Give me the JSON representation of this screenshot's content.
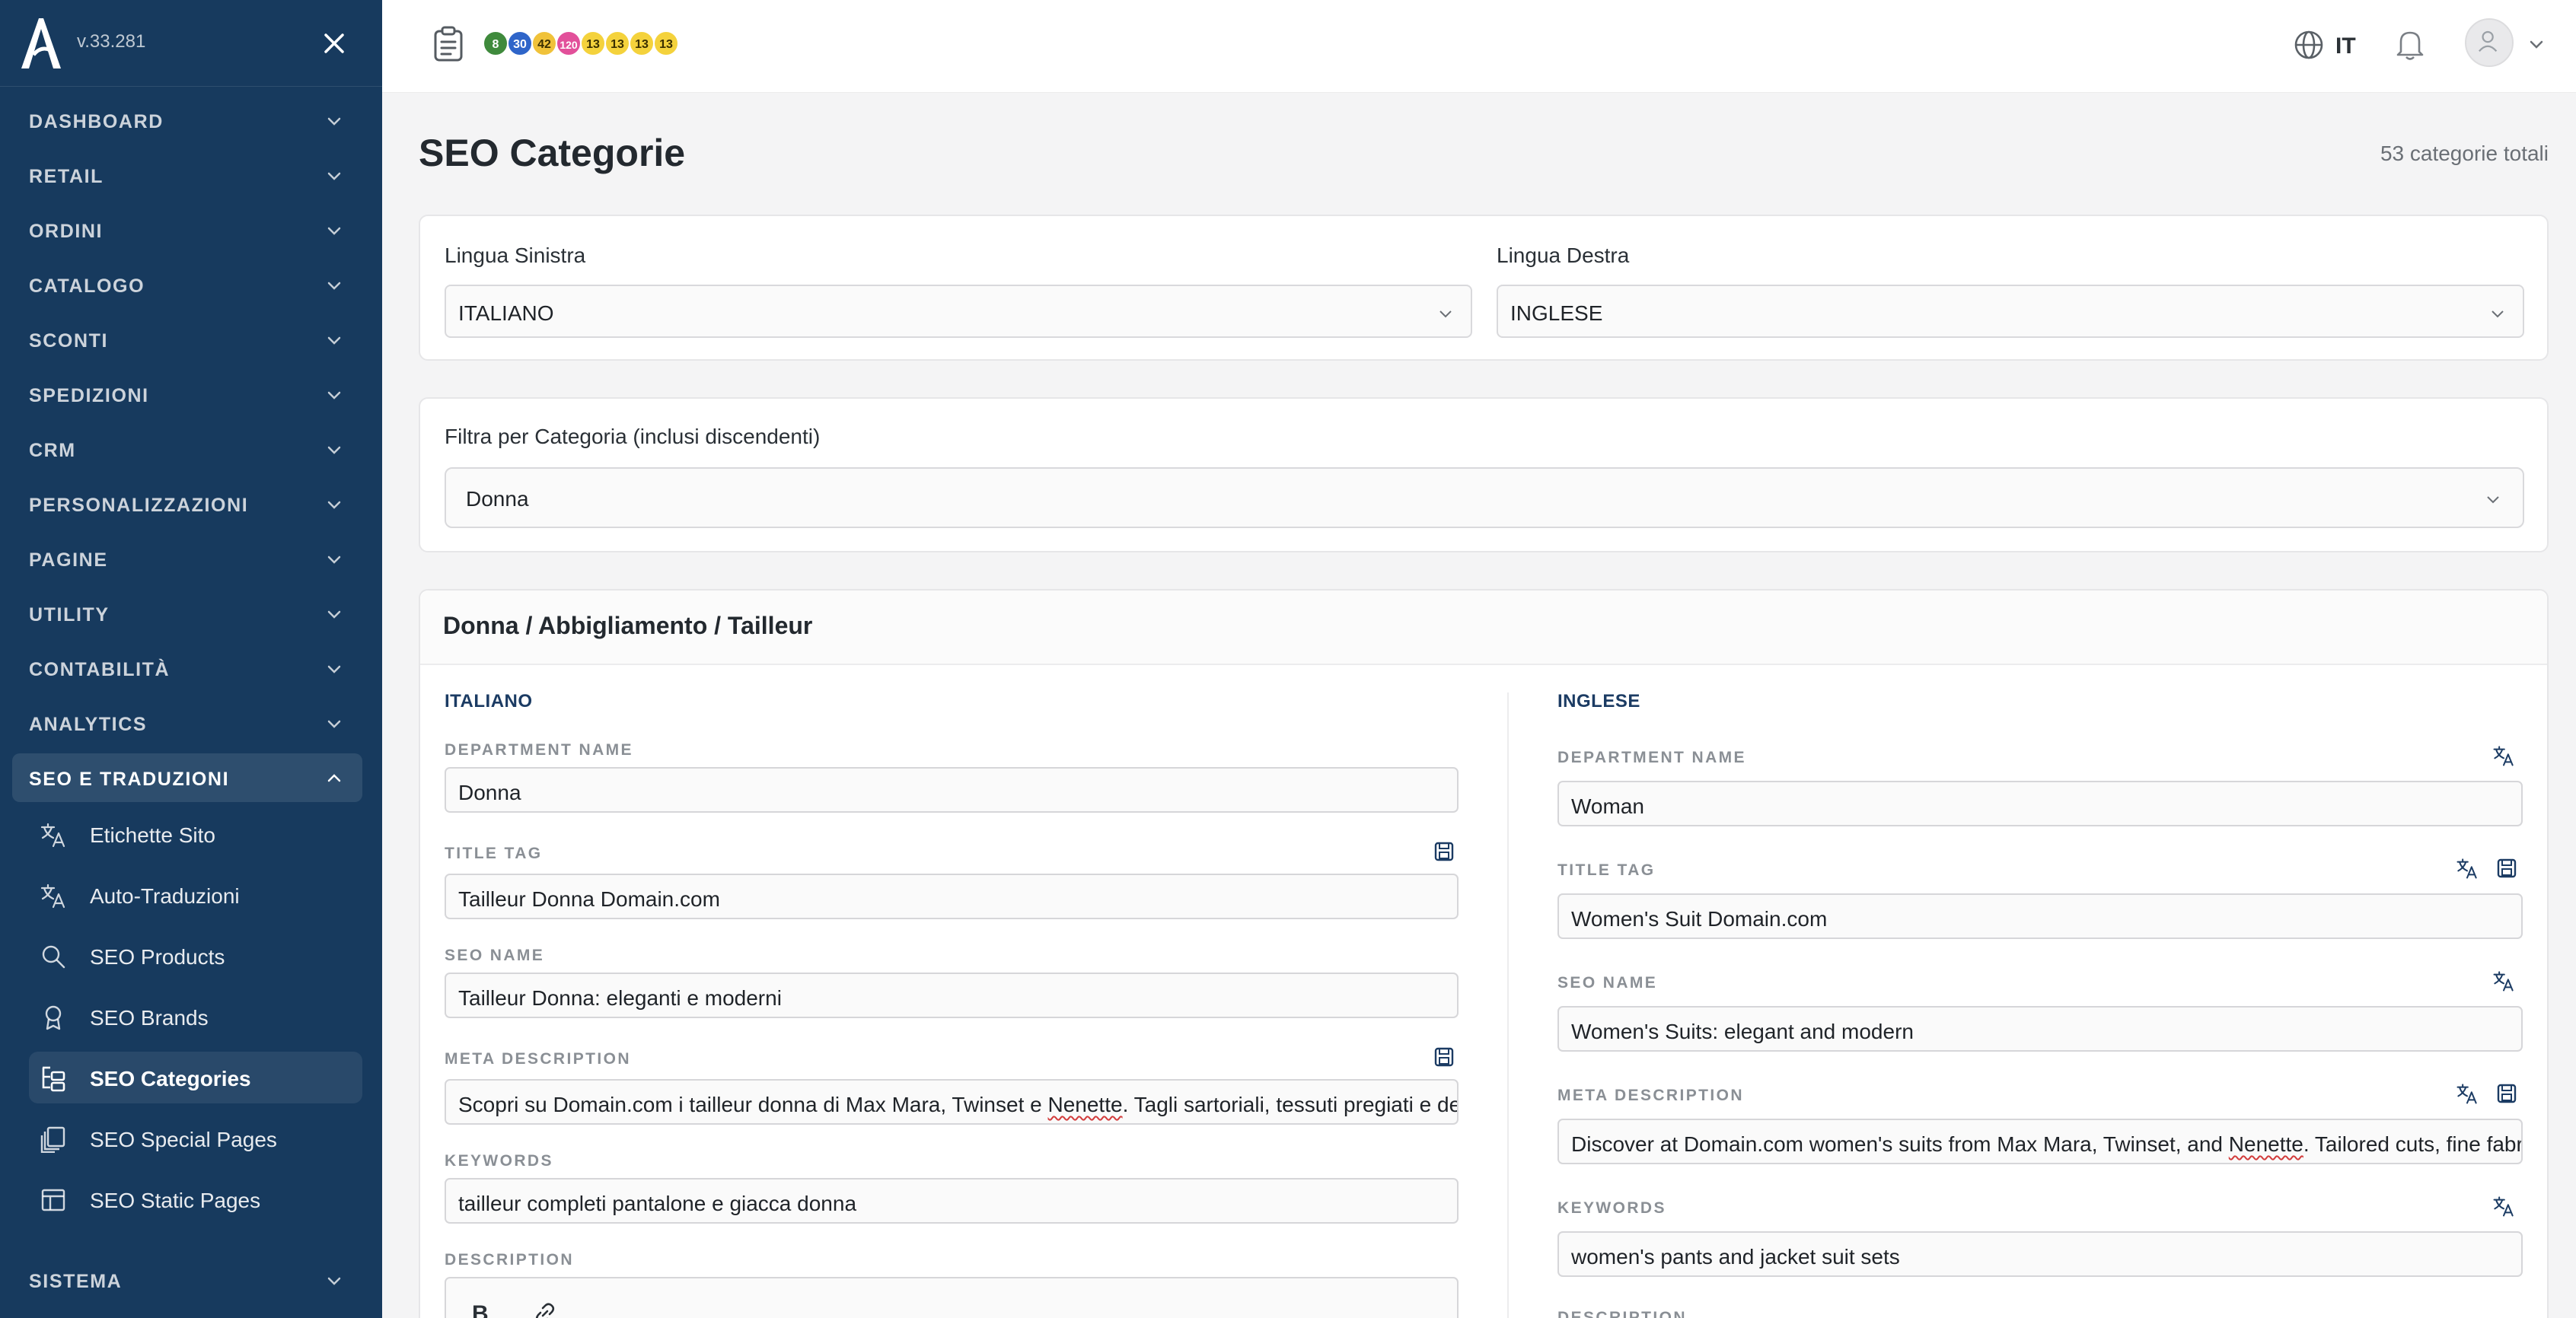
{
  "app": {
    "version": "v.33.281",
    "page_title": "SEO Categorie",
    "total_count": "53 categorie totali"
  },
  "sidebar": {
    "menu": [
      {
        "label": "DASHBOARD"
      },
      {
        "label": "RETAIL"
      },
      {
        "label": "ORDINI"
      },
      {
        "label": "CATALOGO"
      },
      {
        "label": "SCONTI"
      },
      {
        "label": "SPEDIZIONI"
      },
      {
        "label": "CRM"
      },
      {
        "label": "PERSONALIZZAZIONI"
      },
      {
        "label": "PAGINE"
      },
      {
        "label": "UTILITY"
      },
      {
        "label": "CONTABILITÀ"
      },
      {
        "label": "ANALYTICS"
      },
      {
        "label": "SEO E TRADUZIONI"
      }
    ],
    "seo_items": [
      {
        "label": "Etichette Sito",
        "icon": "translate-icon"
      },
      {
        "label": "Auto-Traduzioni",
        "icon": "translate-icon"
      },
      {
        "label": "SEO Products",
        "icon": "search-icon"
      },
      {
        "label": "SEO Brands",
        "icon": "award-icon"
      },
      {
        "label": "SEO Categories",
        "icon": "tree-icon"
      },
      {
        "label": "SEO Special Pages",
        "icon": "pages-icon"
      },
      {
        "label": "SEO Static Pages",
        "icon": "layout-icon"
      }
    ],
    "last": {
      "label": "SISTEMA"
    }
  },
  "topbar": {
    "badges": [
      {
        "value": "8",
        "color": "#3f8a3c"
      },
      {
        "value": "30",
        "color": "#2f65c9"
      },
      {
        "value": "42",
        "color": "#f0c23a"
      },
      {
        "value": "120",
        "color": "#e2509a"
      },
      {
        "value": "13",
        "color": "#f4d23c"
      },
      {
        "value": "13",
        "color": "#f4d23c"
      },
      {
        "value": "13",
        "color": "#f4d23c"
      },
      {
        "value": "13",
        "color": "#f4d23c"
      }
    ],
    "language": "IT"
  },
  "lang_card": {
    "left_label": "Lingua Sinistra",
    "left_value": "ITALIANO",
    "right_label": "Lingua Destra",
    "right_value": "INGLESE"
  },
  "filter_card": {
    "label": "Filtra per Categoria (inclusi discendenti)",
    "value": "Donna"
  },
  "category": {
    "path": "Donna / Abbigliamento / Tailleur",
    "left": {
      "heading": "ITALIANO",
      "department_label": "DEPARTMENT NAME",
      "department": "Donna",
      "title_tag_label": "TITLE TAG",
      "title_tag": "Tailleur Donna Domain.com",
      "seo_name_label": "SEO NAME",
      "seo_name": "Tailleur Donna: eleganti e moderni",
      "meta_label": "META DESCRIPTION",
      "meta_a": "Scopri su Domain.com i tailleur donna di Max Mara, Twinset e ",
      "meta_b": "Nenette",
      "meta_c": ". Tagli sartoriali, tessuti pregiati e de",
      "keywords_label": "KEYWORDS",
      "keywords": "tailleur completi pantalone e giacca donna",
      "description_label": "DESCRIPTION"
    },
    "right": {
      "heading": "INGLESE",
      "department_label": "DEPARTMENT NAME",
      "department": "Woman",
      "title_tag_label": "TITLE TAG",
      "title_tag": "Women's Suit Domain.com",
      "seo_name_label": "SEO NAME",
      "seo_name": "Women's Suits: elegant and modern",
      "meta_label": "META DESCRIPTION",
      "meta_a": "Discover at Domain.com women's suits from Max Mara, Twinset, and ",
      "meta_b": "Nenette",
      "meta_c": ". Tailored cuts, fine fabri",
      "keywords_label": "KEYWORDS",
      "keywords": "women's pants and jacket suit sets",
      "description_label": "DESCRIPTION"
    }
  }
}
